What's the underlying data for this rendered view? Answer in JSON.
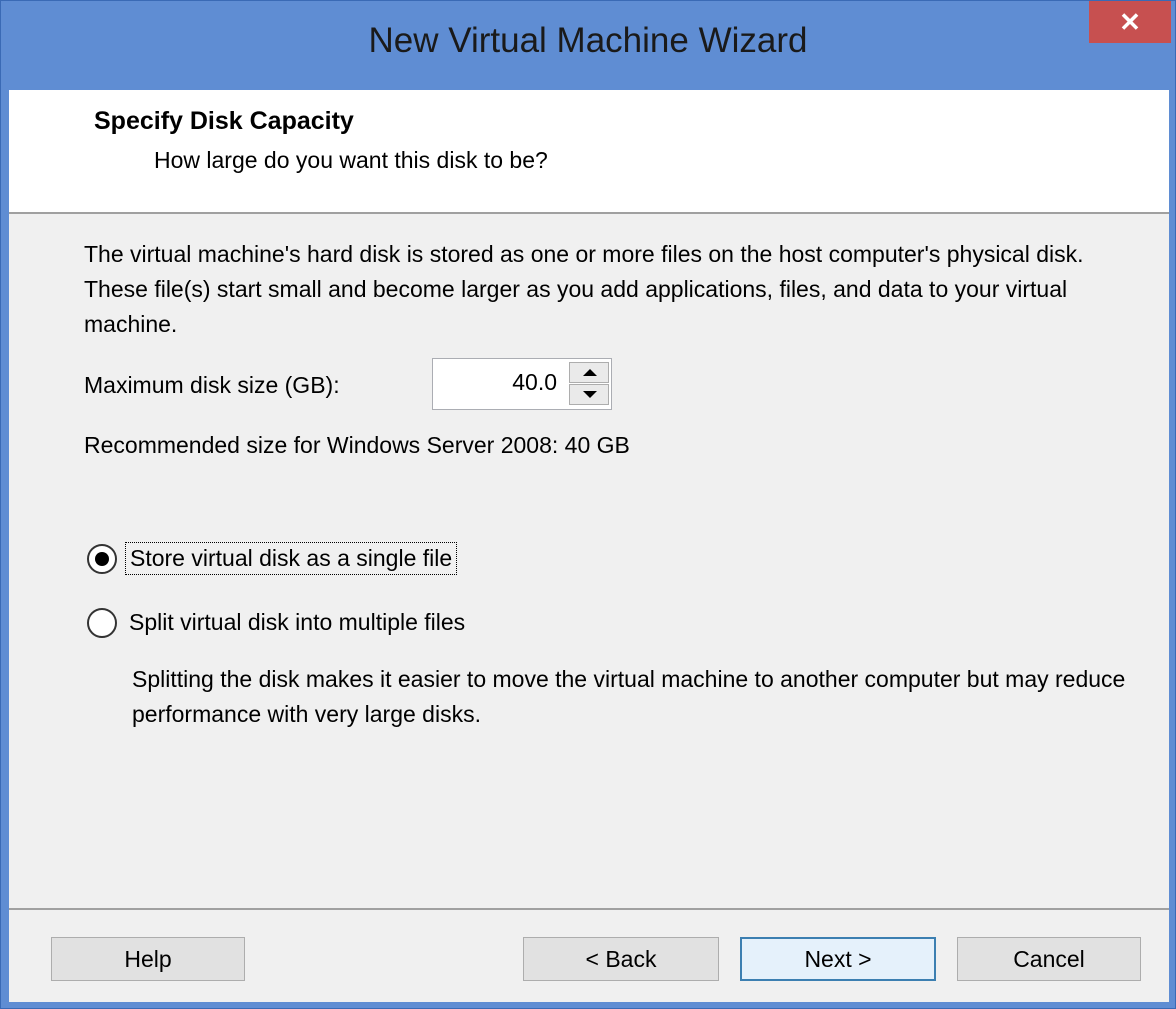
{
  "window": {
    "title": "New Virtual Machine Wizard",
    "close_glyph": "✕"
  },
  "header": {
    "title": "Specify Disk Capacity",
    "subtitle": "How large do you want this disk to be?"
  },
  "body": {
    "description": "The virtual machine's hard disk is stored as one or more files on the host computer's physical disk. These file(s) start small and become larger as you add applications, files, and data to your virtual machine.",
    "disk_size_label": "Maximum disk size (GB):",
    "disk_size_value": "40.0",
    "recommended": "Recommended size for Windows Server 2008: 40 GB",
    "options": [
      {
        "label": "Store virtual disk as a single file",
        "selected": true
      },
      {
        "label": "Split virtual disk into multiple files",
        "selected": false
      }
    ],
    "split_note": "Splitting the disk makes it easier to move the virtual machine to another computer but may reduce performance with very large disks."
  },
  "buttons": {
    "help": "Help",
    "back": "< Back",
    "next": "Next >",
    "cancel": "Cancel"
  },
  "colors": {
    "titlebar": "#5f8dd3",
    "close": "#c75050",
    "client": "#f0f0f0",
    "default_button_border": "#3c7fb1"
  }
}
